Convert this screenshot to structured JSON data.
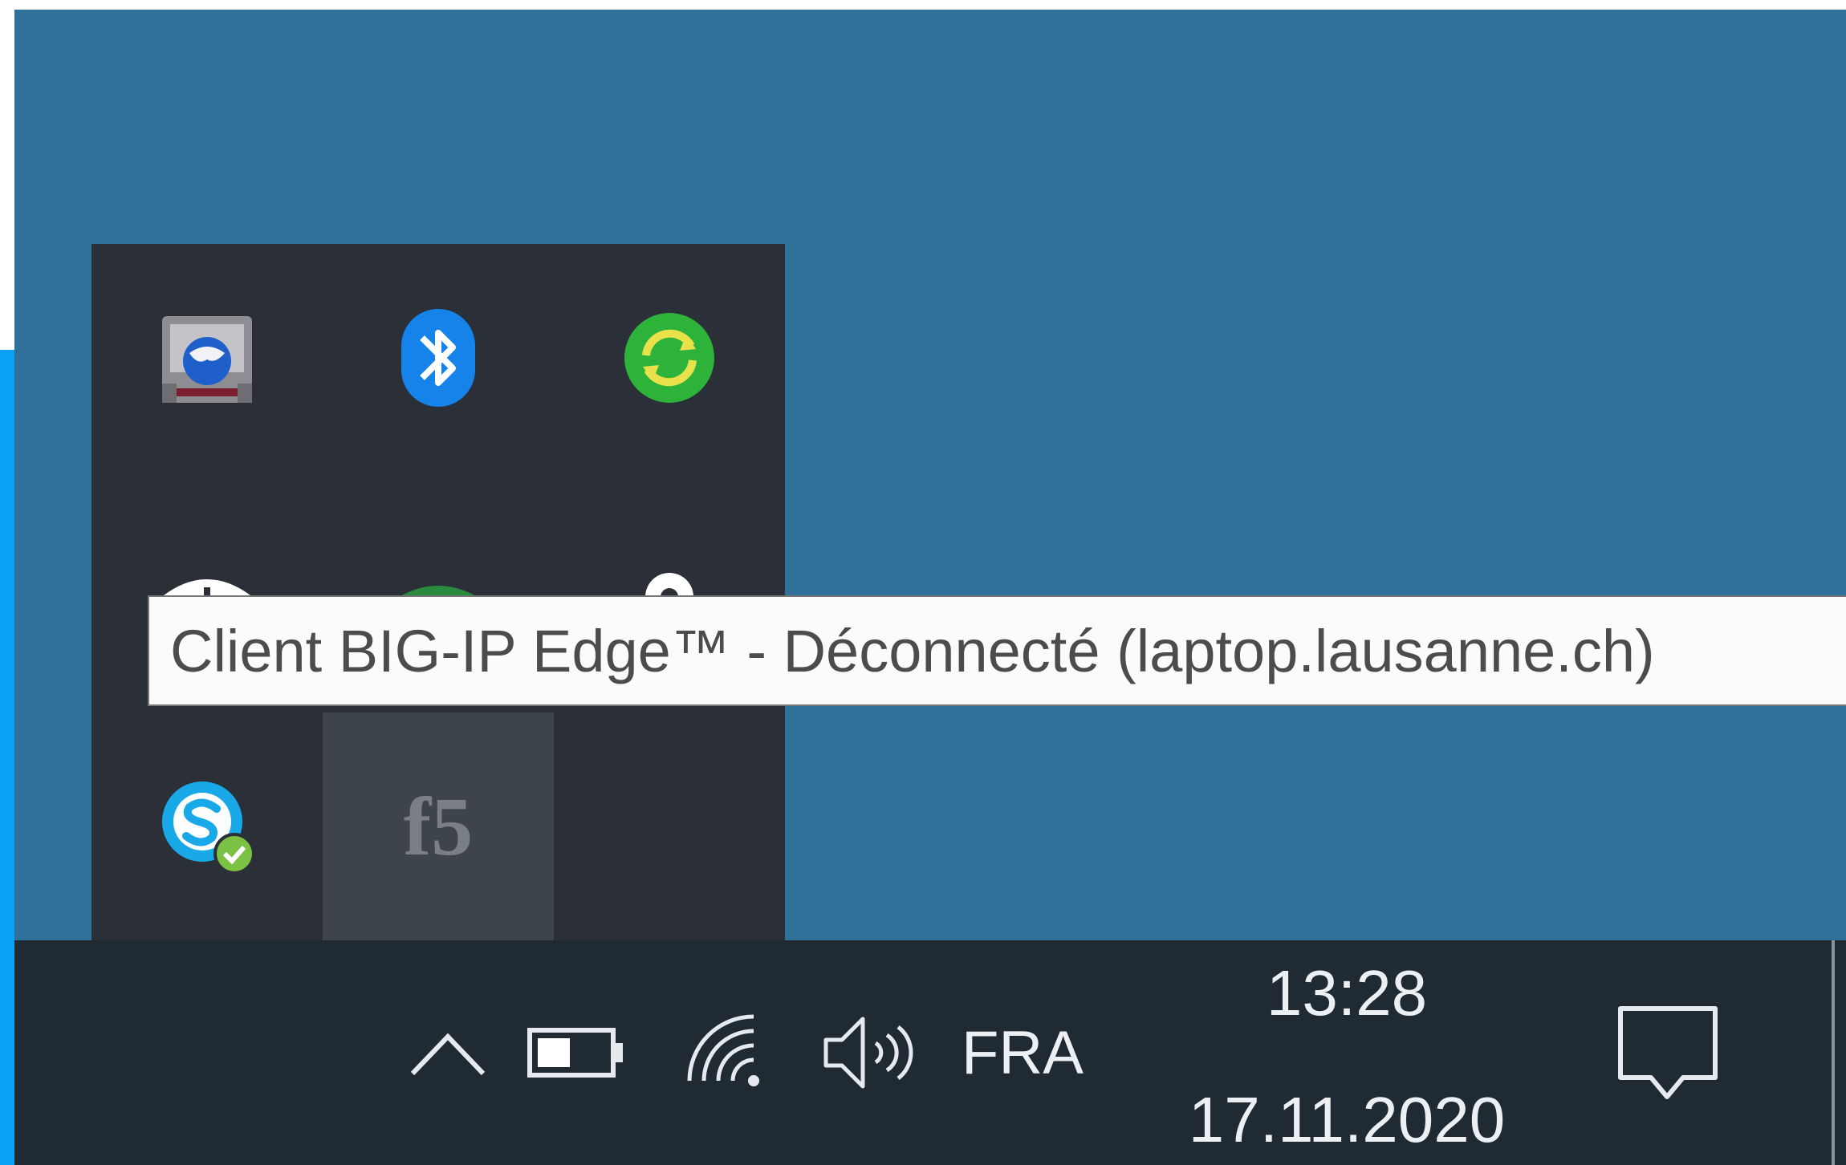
{
  "tooltip": {
    "text": "Client BIG-IP Edge™ - Déconnecté (laptop.lausanne.ch)"
  },
  "tray_flyout": {
    "icons": [
      {
        "name": "network-globe-icon"
      },
      {
        "name": "bluetooth-icon"
      },
      {
        "name": "sync-icon"
      },
      {
        "name": "shield-app-icon"
      },
      {
        "name": "green-app-icon"
      },
      {
        "name": "location-pin-icon"
      },
      {
        "name": "skype-icon"
      },
      {
        "name": "f5-icon",
        "label": "f5"
      }
    ]
  },
  "taskbar": {
    "language": "FRA",
    "time": "13:28",
    "date": "17.11.2020",
    "icons": [
      "chevron-up-icon",
      "battery-icon",
      "wifi-icon",
      "volume-icon",
      "notification-icon"
    ]
  },
  "colors": {
    "desktop": "#2f7199",
    "flyout": "#2b3038",
    "taskbar": "#1f2a33",
    "accent": "#0aa0f5"
  }
}
